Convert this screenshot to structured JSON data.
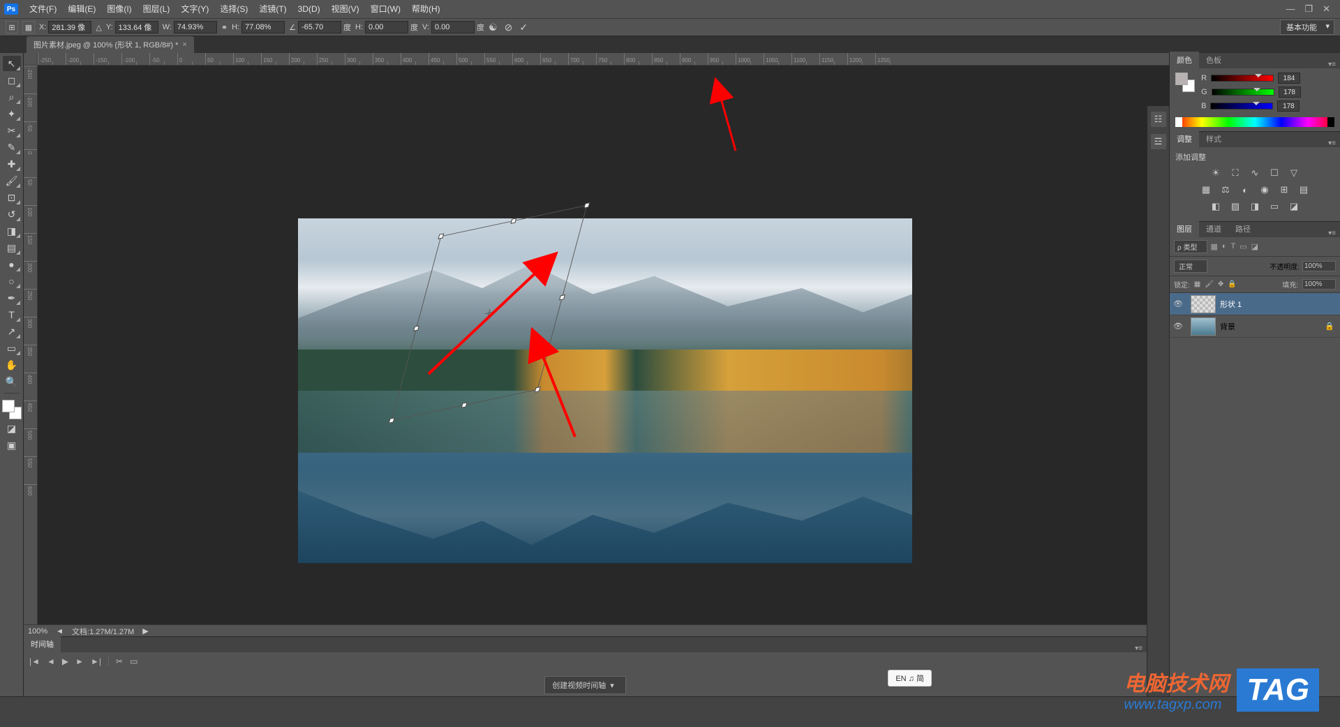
{
  "menubar": {
    "items": [
      "文件(F)",
      "编辑(E)",
      "图像(I)",
      "图层(L)",
      "文字(Y)",
      "选择(S)",
      "滤镜(T)",
      "3D(D)",
      "视图(V)",
      "窗口(W)",
      "帮助(H)"
    ]
  },
  "window_controls": {
    "minimize": "—",
    "maximize": "❐",
    "close": "✕"
  },
  "options_bar": {
    "x_label": "X:",
    "x_value": "281.39 像",
    "y_label": "Y:",
    "y_value": "133.64 像",
    "w_label": "W:",
    "w_value": "74.93%",
    "h_label": "H:",
    "h_value": "77.08%",
    "angle_label": "∠",
    "angle_value": "-65.70",
    "deg": "度",
    "shear_h_label": "H:",
    "shear_h_value": "0.00",
    "shear_v_label": "V:",
    "shear_v_value": "0.00",
    "workspace": "基本功能"
  },
  "document_tab": {
    "title": "图片素材.jpeg @ 100% (形状 1, RGB/8#) *"
  },
  "ruler_h": [
    -250,
    -200,
    -150,
    -100,
    -50,
    0,
    50,
    100,
    150,
    200,
    250,
    300,
    350,
    400,
    450,
    500,
    550,
    600,
    650,
    700,
    750,
    800,
    850,
    900,
    950,
    1000,
    1050,
    1100,
    1150,
    1200,
    1250
  ],
  "ruler_v": [
    -150,
    -100,
    -50,
    0,
    50,
    100,
    150,
    200,
    250,
    300,
    350,
    400,
    450,
    500,
    550,
    600
  ],
  "status": {
    "zoom": "100%",
    "doc": "文档:1.27M/1.27M"
  },
  "color_panel": {
    "tabs": [
      "颜色",
      "色板"
    ],
    "r_label": "R",
    "g_label": "G",
    "b_label": "B",
    "r_value": "184",
    "g_value": "178",
    "b_value": "178"
  },
  "adjustments_panel": {
    "tabs": [
      "调整",
      "样式"
    ],
    "hint": "添加调整"
  },
  "layers_panel": {
    "tabs": [
      "图层",
      "通道",
      "路径"
    ],
    "filter_label": "ρ 类型",
    "blend_mode": "正常",
    "opacity_label": "不透明度:",
    "opacity_value": "100%",
    "lock_label": "锁定:",
    "fill_label": "填充:",
    "fill_value": "100%",
    "layers": [
      {
        "name": "形状 1",
        "visible": true,
        "selected": true,
        "locked": false
      },
      {
        "name": "背景",
        "visible": true,
        "selected": false,
        "locked": true
      }
    ]
  },
  "timeline": {
    "tab": "时间轴",
    "create_btn": "创建视频时间轴"
  },
  "ime": "EN ♫ 简",
  "watermark": {
    "cn": "电脑技术网",
    "url": "www.tagxp.com",
    "tag": "TAG"
  }
}
